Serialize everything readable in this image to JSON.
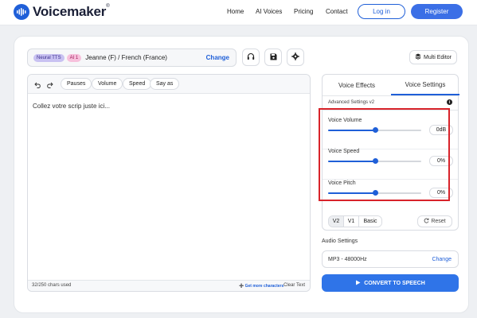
{
  "nav": {
    "brand": "Voicemaker",
    "brand_mark": "®",
    "links": [
      "Home",
      "AI Voices",
      "Pricing",
      "Contact"
    ],
    "login": "Log in",
    "register": "Register"
  },
  "voice": {
    "badge_neural": "Neural TTS",
    "badge_ai": "AI 1",
    "name": "Jeanne (F) / French (France)",
    "change": "Change"
  },
  "toolbar": {
    "pauses": "Pauses",
    "volume": "Volume",
    "speed": "Speed",
    "say_as": "Say as",
    "multi_editor": "Multi Editor"
  },
  "editor": {
    "placeholder": "Collez votre scrip juste ici...",
    "chars_used": "32/250 chars used",
    "get_more": "Get more characters",
    "clear": "Clear Text"
  },
  "settings": {
    "tabs": [
      "Voice Effects",
      "Voice Settings"
    ],
    "active_tab": "Voice Settings",
    "advanced_label": "Advanced Settings v2",
    "sliders": [
      {
        "label": "Voice Volume",
        "value": "0dB",
        "position": 0.5
      },
      {
        "label": "Voice Speed",
        "value": "0%",
        "position": 0.5
      },
      {
        "label": "Voice Pitch",
        "value": "0%",
        "position": 0.5
      }
    ],
    "versions": [
      "V2",
      "V1",
      "Basic"
    ],
    "active_version": "V2",
    "reset": "Reset"
  },
  "audio": {
    "label": "Audio Settings",
    "value": "MP3 - 48000Hz",
    "change": "Change"
  },
  "convert": "CONVERT TO SPEECH",
  "colors": {
    "accent": "#1f5fd8",
    "highlight": "#d8232a"
  }
}
